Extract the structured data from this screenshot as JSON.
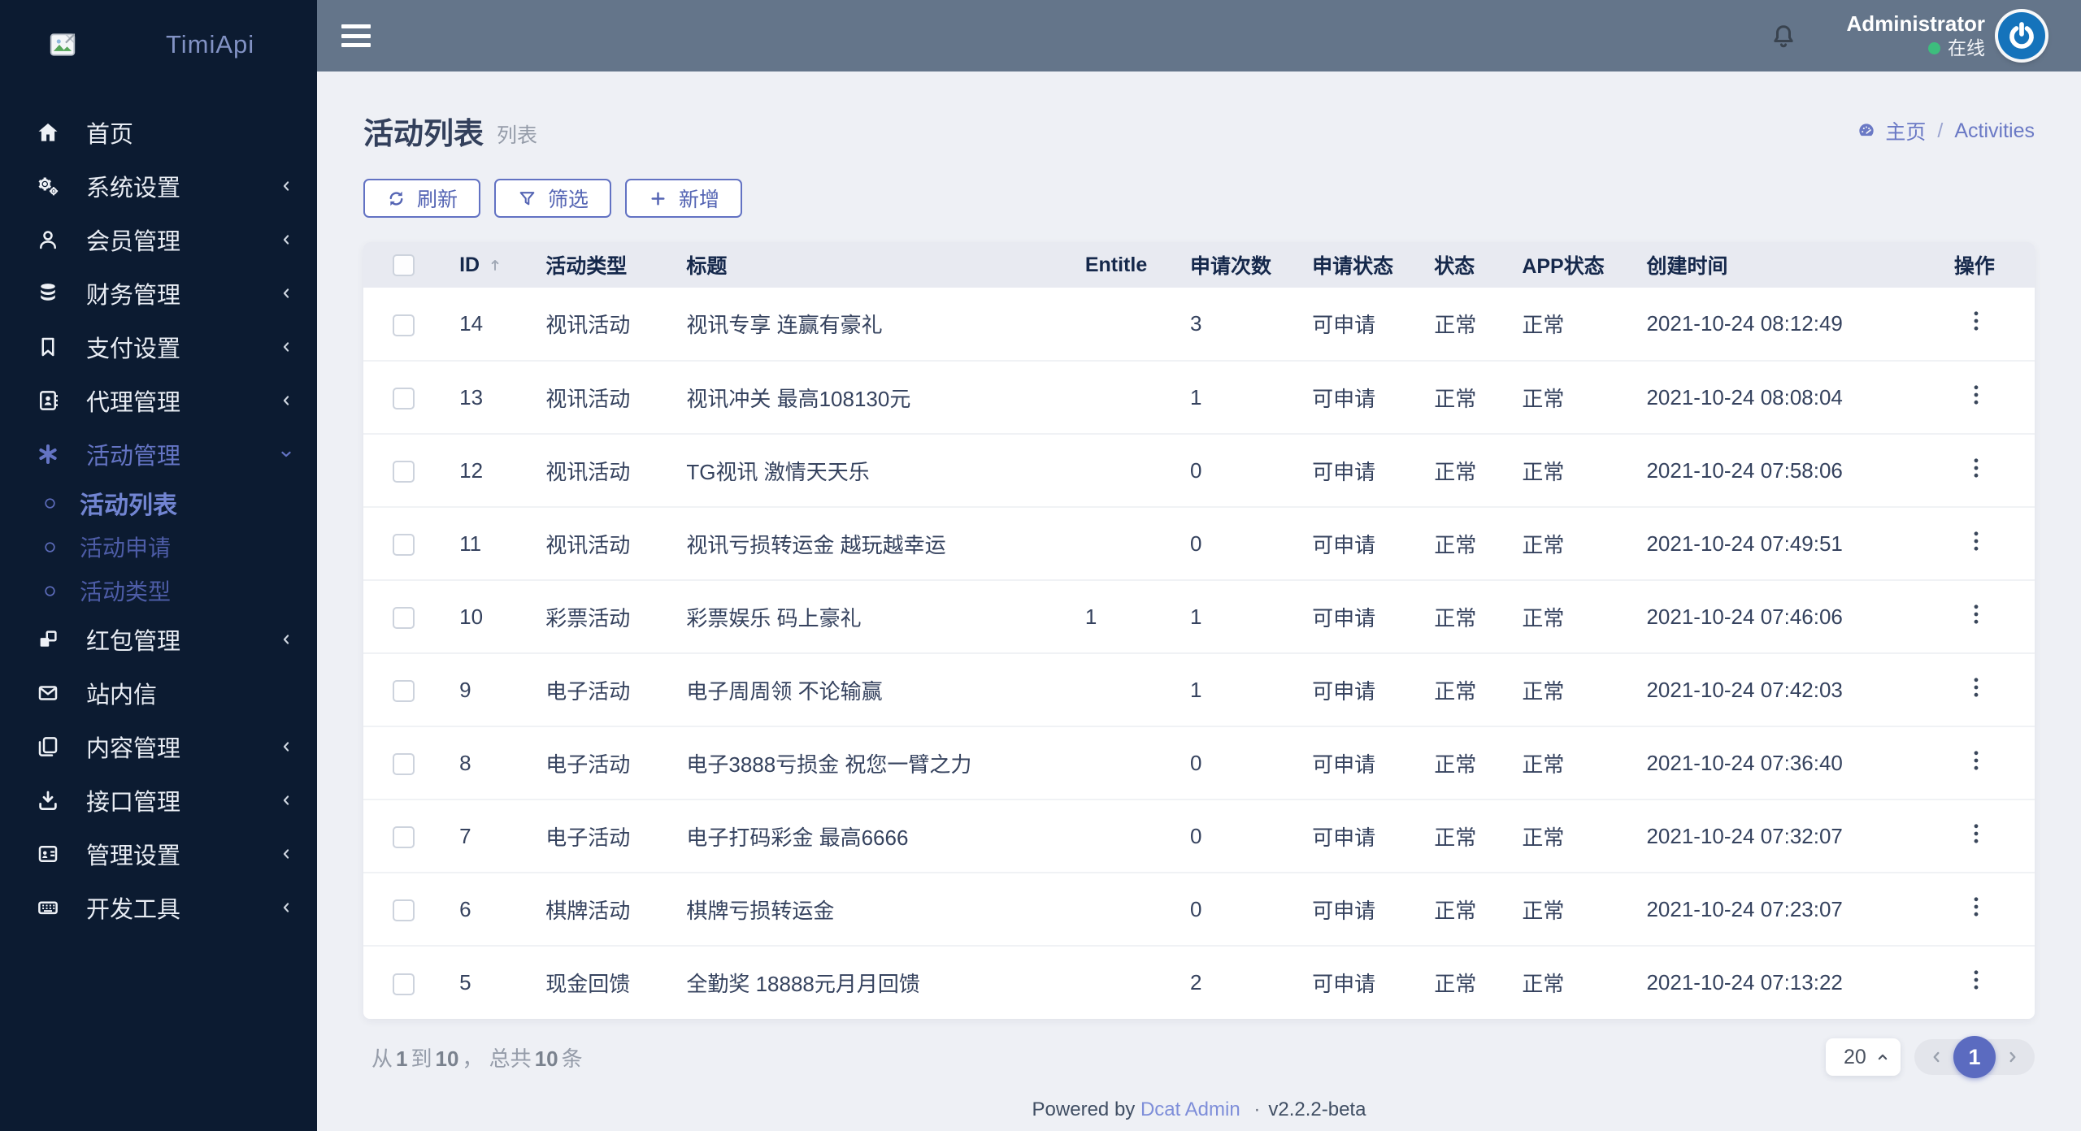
{
  "brand": {
    "name": "TimiApi"
  },
  "topbar": {
    "user": "Administrator",
    "status": "在线"
  },
  "sidebar": {
    "items": [
      {
        "label": "首页",
        "icon": "home-icon"
      },
      {
        "label": "系统设置",
        "icon": "gears-icon",
        "chevron": "left"
      },
      {
        "label": "会员管理",
        "icon": "user-icon",
        "chevron": "left"
      },
      {
        "label": "财务管理",
        "icon": "database-icon",
        "chevron": "left"
      },
      {
        "label": "支付设置",
        "icon": "bookmark-icon",
        "chevron": "left"
      },
      {
        "label": "代理管理",
        "icon": "address-book-icon",
        "chevron": "left"
      },
      {
        "label": "活动管理",
        "icon": "asterisk-icon",
        "chevron": "down",
        "active": true,
        "children": [
          {
            "label": "活动列表",
            "active": true
          },
          {
            "label": "活动申请"
          },
          {
            "label": "活动类型"
          }
        ]
      },
      {
        "label": "红包管理",
        "icon": "cubes-icon",
        "chevron": "left"
      },
      {
        "label": "站内信",
        "icon": "envelope-icon"
      },
      {
        "label": "内容管理",
        "icon": "copy-icon",
        "chevron": "left"
      },
      {
        "label": "接口管理",
        "icon": "download-icon",
        "chevron": "left"
      },
      {
        "label": "管理设置",
        "icon": "id-card-icon",
        "chevron": "left"
      },
      {
        "label": "开发工具",
        "icon": "keyboard-icon",
        "chevron": "left"
      }
    ]
  },
  "page": {
    "title": "活动列表",
    "subtitle": "列表",
    "breadcrumb": {
      "home": "主页",
      "separator": "/",
      "current": "Activities"
    }
  },
  "toolbar": {
    "refresh_label": "刷新",
    "filter_label": "筛选",
    "add_label": "新增"
  },
  "table": {
    "columns": [
      "",
      "ID",
      "活动类型",
      "标题",
      "Entitle",
      "申请次数",
      "申请状态",
      "状态",
      "APP状态",
      "创建时间",
      "操作"
    ],
    "rows": [
      {
        "id": "14",
        "type": "视讯活动",
        "title": "视讯专享 连赢有豪礼",
        "entitle": "",
        "count": "3",
        "apply_status": "可申请",
        "status": "正常",
        "app_status": "正常",
        "created_at": "2021-10-24 08:12:49"
      },
      {
        "id": "13",
        "type": "视讯活动",
        "title": "视讯冲关 最高108130元",
        "entitle": "",
        "count": "1",
        "apply_status": "可申请",
        "status": "正常",
        "app_status": "正常",
        "created_at": "2021-10-24 08:08:04"
      },
      {
        "id": "12",
        "type": "视讯活动",
        "title": "TG视讯 激情天天乐",
        "entitle": "",
        "count": "0",
        "apply_status": "可申请",
        "status": "正常",
        "app_status": "正常",
        "created_at": "2021-10-24 07:58:06"
      },
      {
        "id": "11",
        "type": "视讯活动",
        "title": "视讯亏损转运金 越玩越幸运",
        "entitle": "",
        "count": "0",
        "apply_status": "可申请",
        "status": "正常",
        "app_status": "正常",
        "created_at": "2021-10-24 07:49:51"
      },
      {
        "id": "10",
        "type": "彩票活动",
        "title": "彩票娱乐 码上豪礼",
        "entitle": "1",
        "count": "1",
        "apply_status": "可申请",
        "status": "正常",
        "app_status": "正常",
        "created_at": "2021-10-24 07:46:06"
      },
      {
        "id": "9",
        "type": "电子活动",
        "title": "电子周周领 不论输赢",
        "entitle": "",
        "count": "1",
        "apply_status": "可申请",
        "status": "正常",
        "app_status": "正常",
        "created_at": "2021-10-24 07:42:03"
      },
      {
        "id": "8",
        "type": "电子活动",
        "title": "电子3888亏损金 祝您一臂之力",
        "entitle": "",
        "count": "0",
        "apply_status": "可申请",
        "status": "正常",
        "app_status": "正常",
        "created_at": "2021-10-24 07:36:40"
      },
      {
        "id": "7",
        "type": "电子活动",
        "title": "电子打码彩金 最高6666",
        "entitle": "",
        "count": "0",
        "apply_status": "可申请",
        "status": "正常",
        "app_status": "正常",
        "created_at": "2021-10-24 07:32:07"
      },
      {
        "id": "6",
        "type": "棋牌活动",
        "title": "棋牌亏损转运金",
        "entitle": "",
        "count": "0",
        "apply_status": "可申请",
        "status": "正常",
        "app_status": "正常",
        "created_at": "2021-10-24 07:23:07"
      },
      {
        "id": "5",
        "type": "现金回馈",
        "title": "全勤奖 18888元月月回馈",
        "entitle": "",
        "count": "2",
        "apply_status": "可申请",
        "status": "正常",
        "app_status": "正常",
        "created_at": "2021-10-24 07:13:22"
      }
    ]
  },
  "pagination": {
    "per_page": "20",
    "current_page": "1",
    "summary": {
      "from_label": "从",
      "from": "1",
      "to_label": "到",
      "to": "10",
      "comma": "，",
      "total_label": "总共",
      "total": "10",
      "unit": "条"
    }
  },
  "footer": {
    "powered_by": "Powered by",
    "brand_link": "Dcat Admin",
    "separator": "·",
    "version": "v2.2.2-beta"
  },
  "colors": {
    "accent": "#5b6bc0",
    "sidebar_bg": "#0c1b31",
    "topbar_bg": "#64758a",
    "avatar_bg": "#1573bb",
    "online_dot": "#3dbd7d"
  }
}
